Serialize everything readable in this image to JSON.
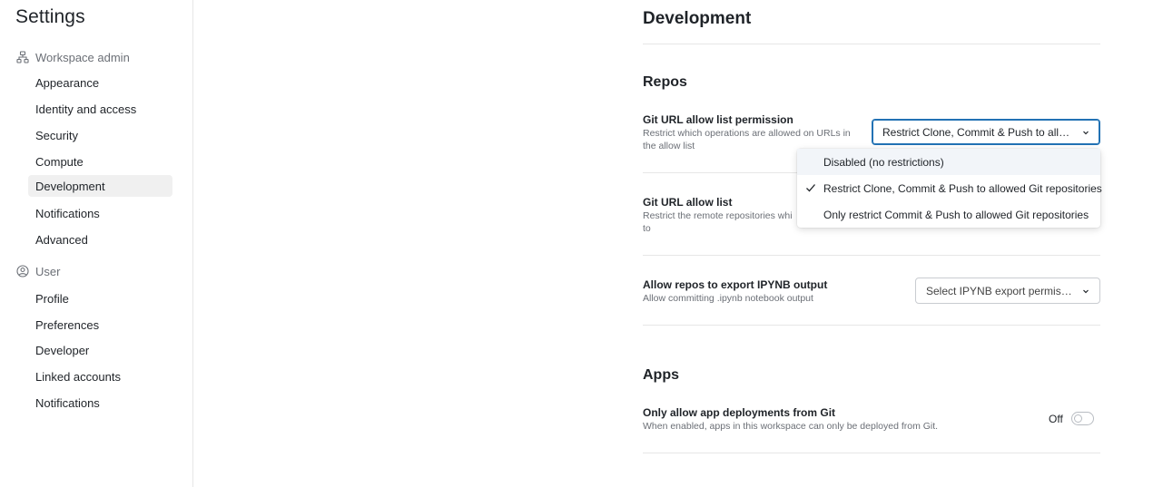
{
  "sidebar": {
    "title": "Settings",
    "workspace_admin": {
      "header": "Workspace admin",
      "icon": "workspace-icon",
      "items": [
        "Appearance",
        "Identity and access",
        "Security",
        "Compute",
        "Development",
        "Notifications",
        "Advanced"
      ],
      "active": "Development"
    },
    "user": {
      "header": "User",
      "icon": "user-circle-icon",
      "items": [
        "Profile",
        "Preferences",
        "Developer",
        "Linked accounts",
        "Notifications"
      ]
    }
  },
  "main": {
    "title": "Development",
    "repos": {
      "title": "Repos",
      "git_url_permission": {
        "label": "Git URL allow list permission",
        "description": "Restrict which operations are allowed on URLs in the allow list",
        "selected": "Restrict Clone, Commit & Push to allow...",
        "options": [
          "Disabled (no restrictions)",
          "Restrict Clone, Commit & Push to allowed Git repositories",
          "Only restrict Commit & Push to allowed Git repositories"
        ],
        "checked_index": 1
      },
      "git_url_list": {
        "label": "Git URL allow list",
        "description": "Restrict the remote repositories whi",
        "description_line2": "to"
      },
      "ipynb": {
        "label": "Allow repos to export IPYNB output",
        "description": "Allow committing .ipynb notebook output",
        "placeholder": "Select IPYNB export permissions"
      }
    },
    "apps": {
      "title": "Apps",
      "git_deploy": {
        "label": "Only allow app deployments from Git",
        "description": "When enabled, apps in this workspace can only be deployed from Git.",
        "toggle_state": "Off"
      }
    }
  },
  "colors": {
    "accent": "#2272b4",
    "active_nav_bg": "#f0f0f0",
    "muted_text": "#6b6f76",
    "border": "#c9ccd1"
  }
}
